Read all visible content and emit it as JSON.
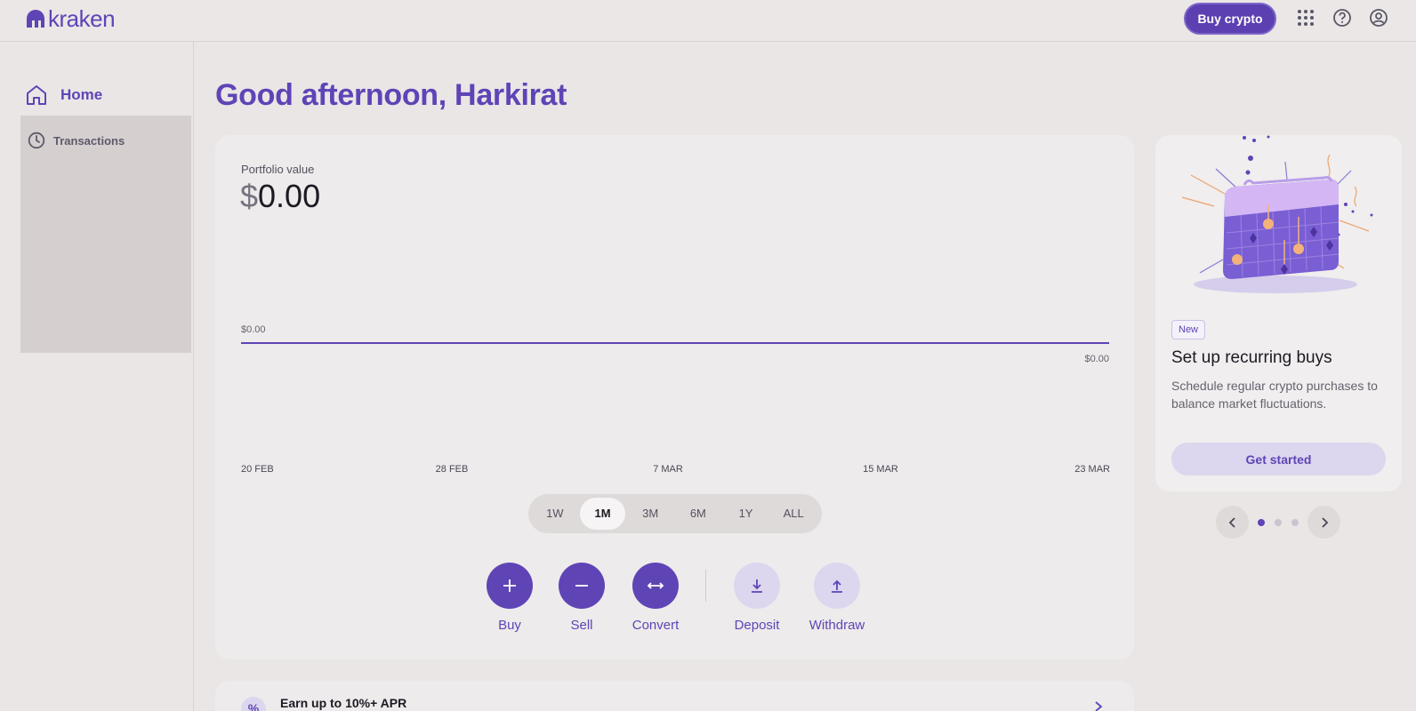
{
  "header": {
    "logo_text": "kraken",
    "buy_crypto_label": "Buy crypto",
    "icons": [
      "apps-grid-icon",
      "help-icon",
      "account-icon"
    ]
  },
  "sidebar": {
    "items": [
      {
        "label": "Home",
        "icon": "home-icon",
        "active": true
      },
      {
        "label": "Transactions",
        "icon": "clock-icon",
        "active": false
      }
    ]
  },
  "main": {
    "greeting": "Good afternoon, Harkirat",
    "portfolio": {
      "label": "Portfolio value",
      "currency_symbol": "$",
      "amount": "0.00"
    },
    "periods": [
      "1W",
      "1M",
      "3M",
      "6M",
      "1Y",
      "ALL"
    ],
    "active_period": "1M",
    "actions": [
      {
        "label": "Buy",
        "icon": "plus-icon",
        "style": "dark"
      },
      {
        "label": "Sell",
        "icon": "minus-icon",
        "style": "dark"
      },
      {
        "label": "Convert",
        "icon": "convert-arrows-icon",
        "style": "dark"
      },
      {
        "label": "Deposit",
        "icon": "download-icon",
        "style": "light"
      },
      {
        "label": "Withdraw",
        "icon": "upload-icon",
        "style": "light"
      }
    ],
    "earn": {
      "title": "Earn up to 10%+ APR",
      "icon": "percent-icon"
    }
  },
  "chart_data": {
    "type": "line",
    "x_tick_labels": [
      "20 FEB",
      "28 FEB",
      "7 MAR",
      "15 MAR",
      "23 MAR"
    ],
    "series": [
      {
        "values": [
          0,
          0,
          0,
          0,
          0
        ]
      }
    ],
    "high_label": "$0.00",
    "low_label": "$0.00",
    "grid": false
  },
  "promo": {
    "badge": "New",
    "title": "Set up recurring buys",
    "description": "Schedule regular crypto purchases to balance market fluctuations.",
    "cta": "Get started",
    "illustration": "calendar-crypto-illustration",
    "carousel_total": 3,
    "carousel_active": 1
  },
  "colors": {
    "brand": "#5f44b6",
    "brand_light": "#dcd6ef",
    "background": "#eae6e6",
    "card": "#edebeb"
  }
}
